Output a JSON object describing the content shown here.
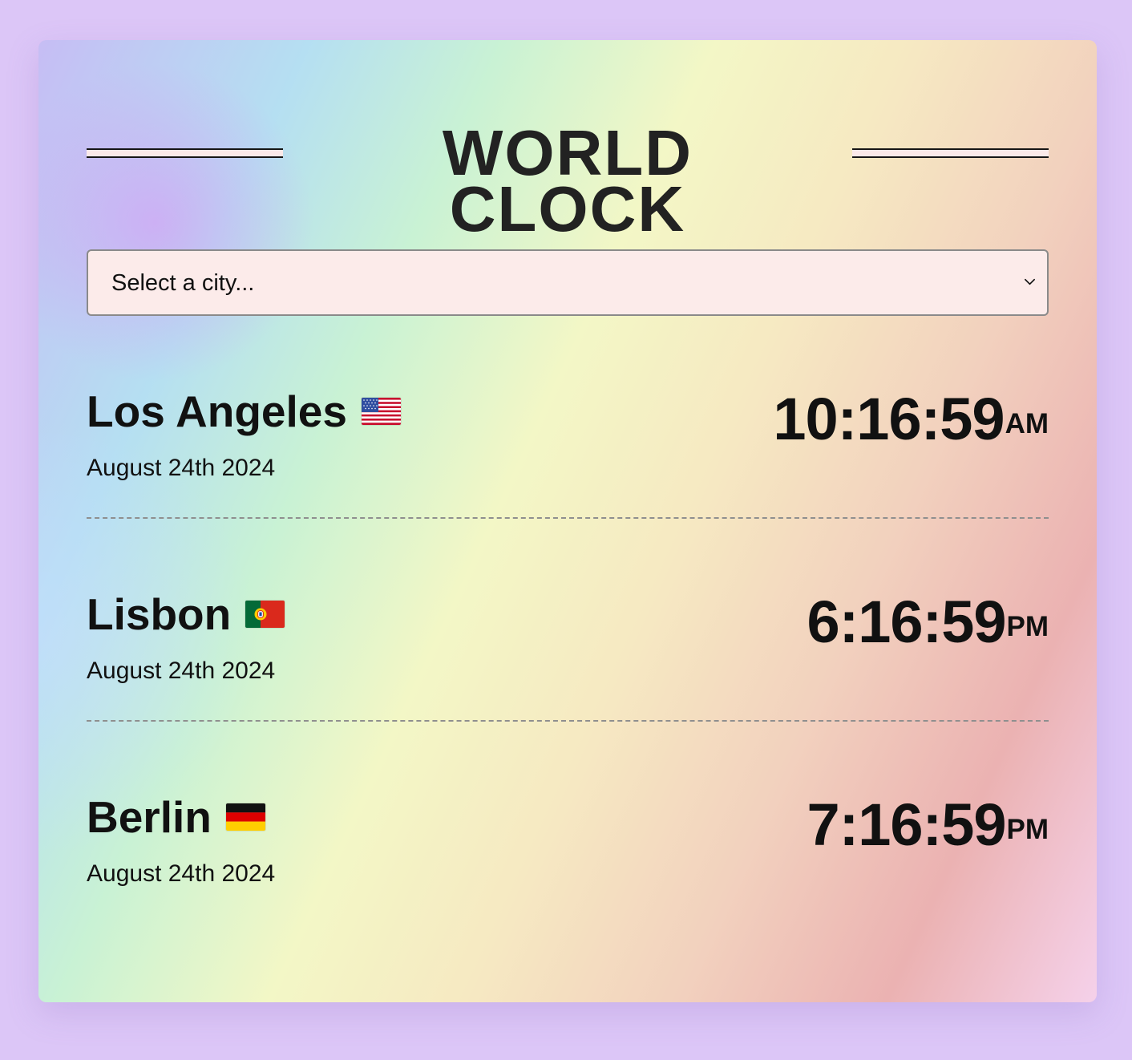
{
  "app": {
    "title": "WORLD CLOCK"
  },
  "selector": {
    "value": "Select a city...",
    "icon": "chevron-down-icon"
  },
  "clocks": [
    {
      "city": "Los Angeles",
      "date": "August 24th 2024",
      "time": "10:16:59",
      "period": "AM",
      "flag": "usa-flag-icon"
    },
    {
      "city": "Lisbon",
      "date": "August 24th 2024",
      "time": "6:16:59",
      "period": "PM",
      "flag": "portugal-flag-icon"
    },
    {
      "city": "Berlin",
      "date": "August 24th 2024",
      "time": "7:16:59",
      "period": "PM",
      "flag": "germany-flag-icon"
    }
  ],
  "colors": {
    "page_background": "#dcc6f7",
    "select_background": "#fcebea",
    "title_text": "#222222",
    "divider": "#8f8f8f"
  }
}
